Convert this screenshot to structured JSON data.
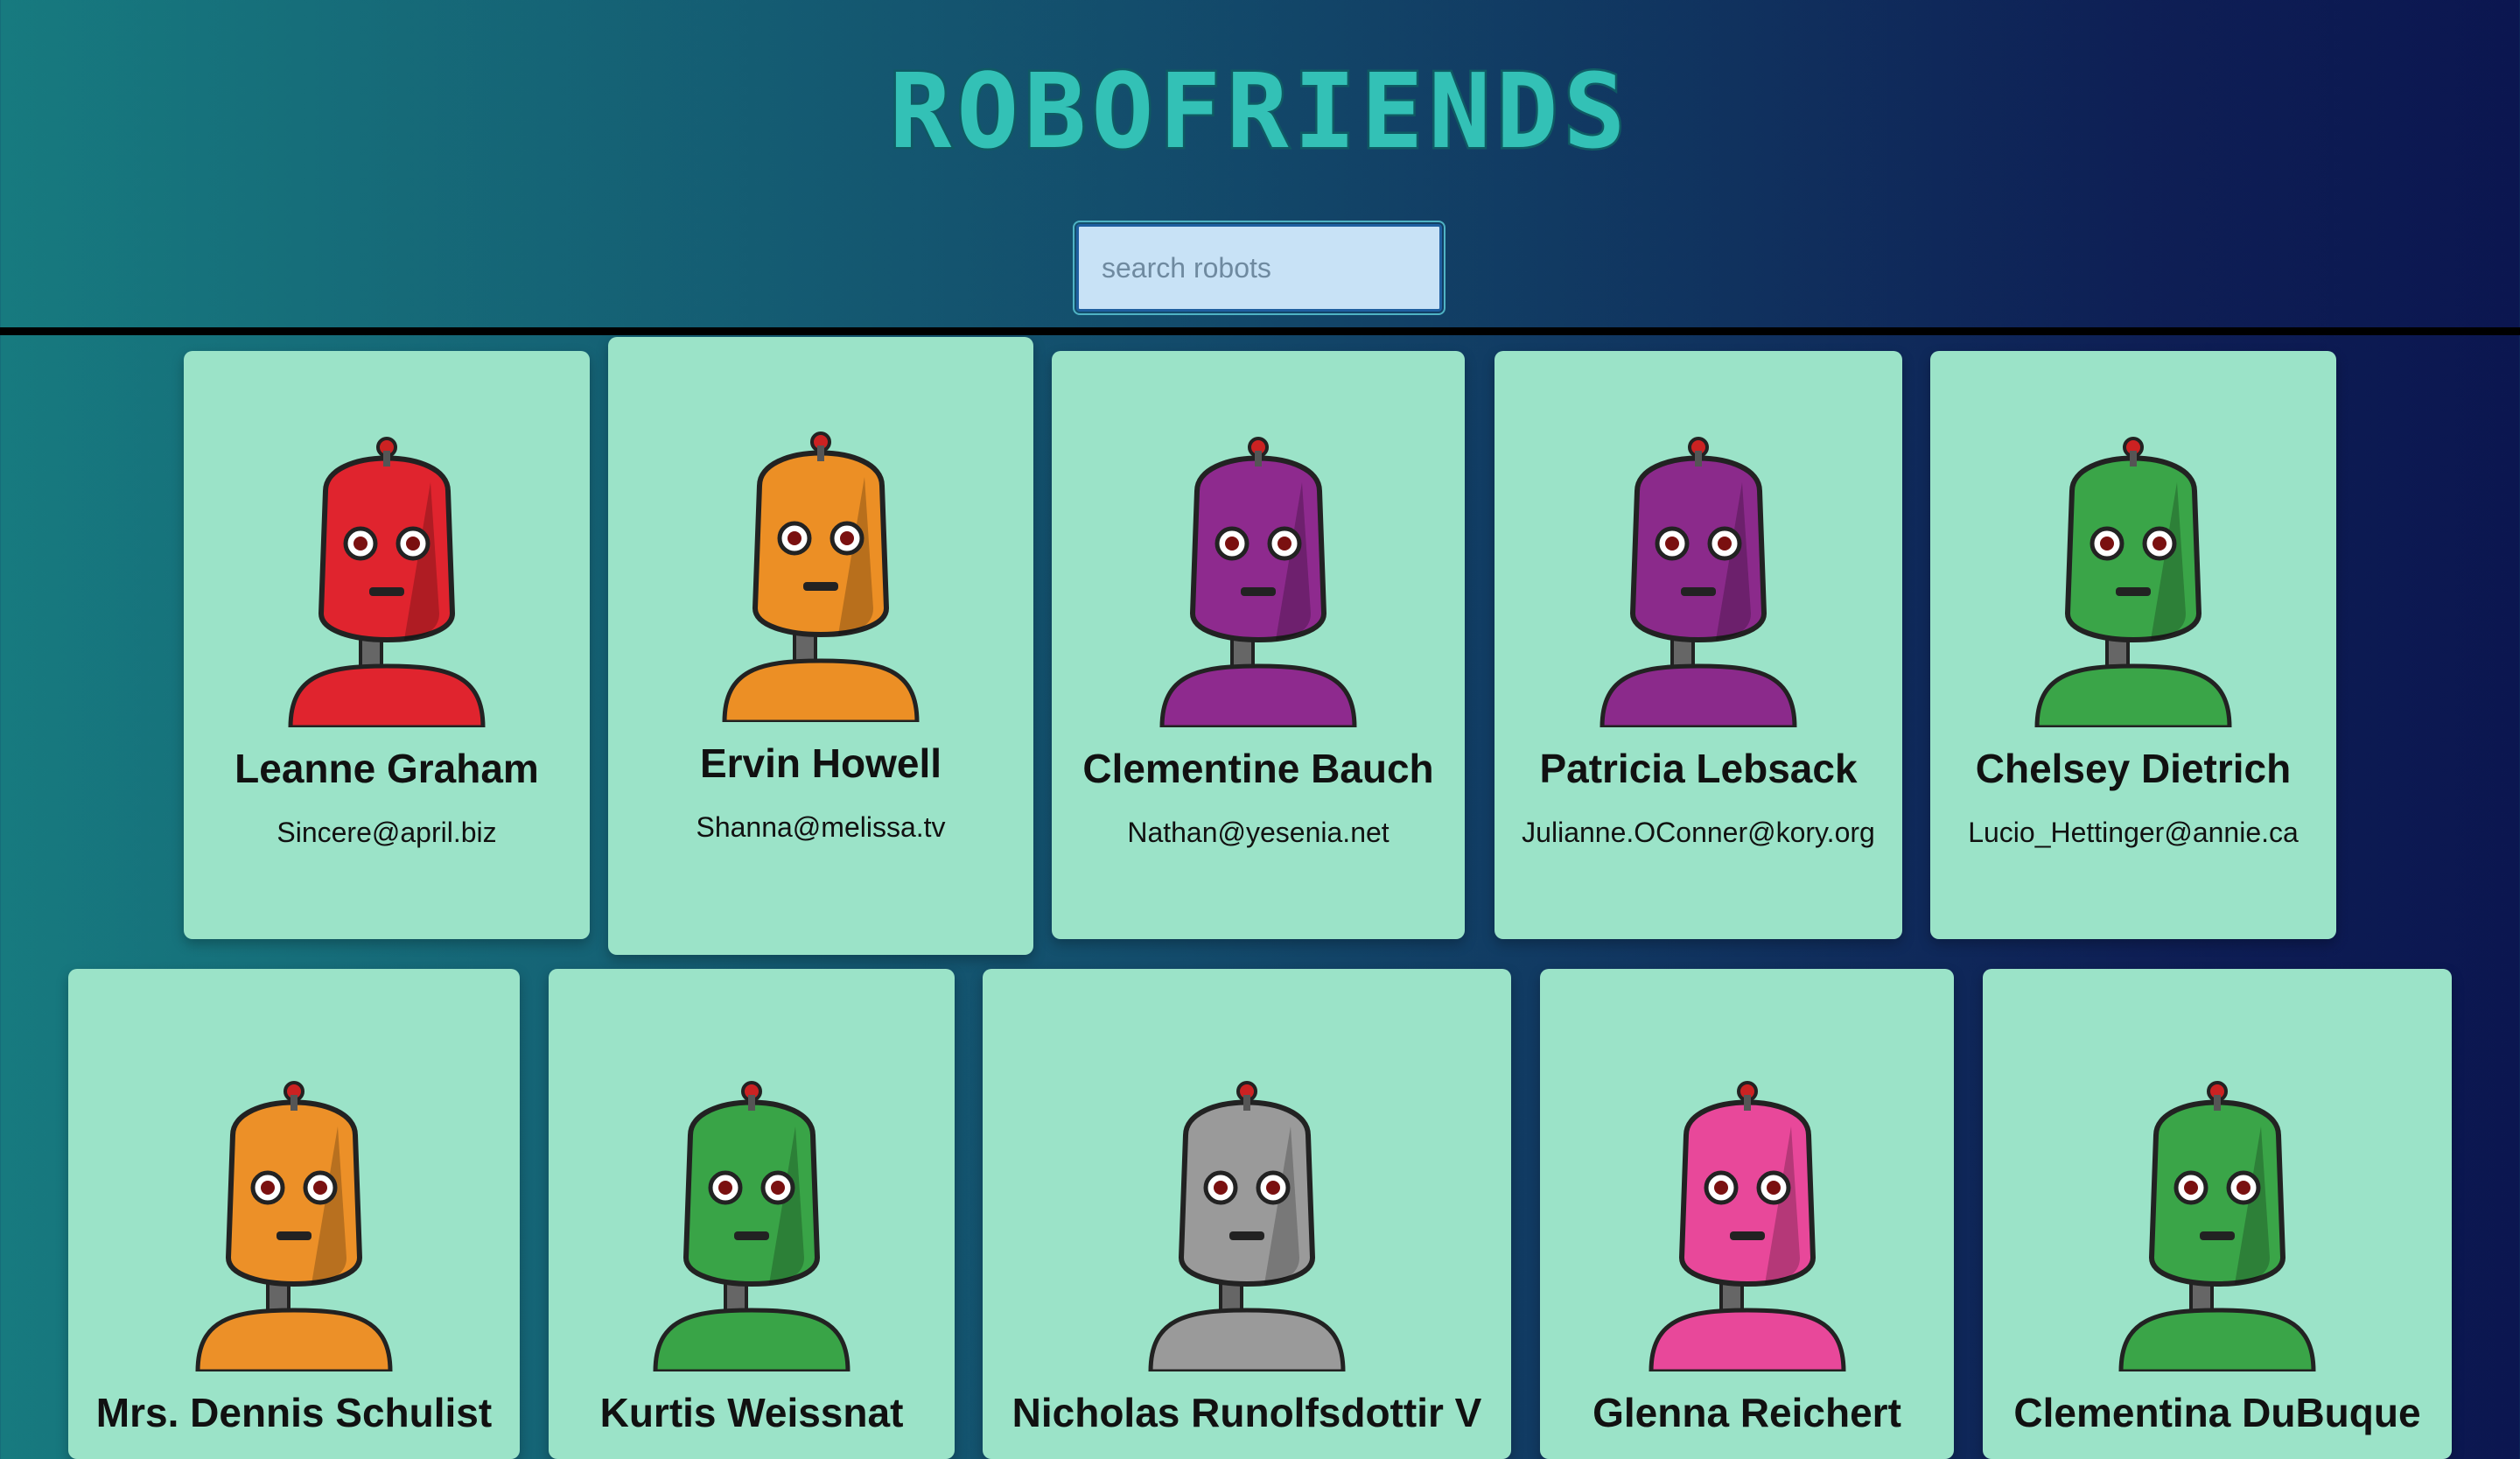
{
  "app": {
    "title": "ROBOFRIENDS"
  },
  "search": {
    "placeholder": "search robots",
    "value": ""
  },
  "robots": [
    {
      "name": "Leanne Graham",
      "email": "Sincere@april.biz",
      "color": "#e0242e"
    },
    {
      "name": "Ervin Howell",
      "email": "Shanna@melissa.tv",
      "color": "#ec8f25"
    },
    {
      "name": "Clementine Bauch",
      "email": "Nathan@yesenia.net",
      "color": "#8e2a8e"
    },
    {
      "name": "Patricia Lebsack",
      "email": "Julianne.OConner@kory.org",
      "color": "#8b2a8b"
    },
    {
      "name": "Chelsey Dietrich",
      "email": "Lucio_Hettinger@annie.ca",
      "color": "#3aa548"
    },
    {
      "name": "Mrs. Dennis Schulist",
      "email": "",
      "color": "#ec9028"
    },
    {
      "name": "Kurtis Weissnat",
      "email": "",
      "color": "#39a447"
    },
    {
      "name": "Nicholas Runolfsdottir V",
      "email": "",
      "color": "#9a9a9a"
    },
    {
      "name": "Glenna Reichert",
      "email": "",
      "color": "#e8489a"
    },
    {
      "name": "Clementina DuBuque",
      "email": "",
      "color": "#3aa548"
    }
  ]
}
